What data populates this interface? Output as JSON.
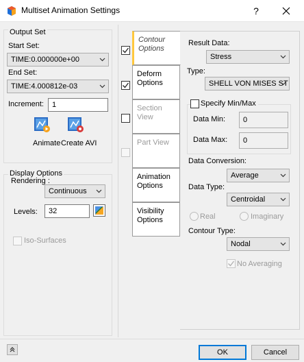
{
  "window": {
    "title": "Multiset Animation Settings",
    "help_label": "?",
    "close_label": "✕"
  },
  "output_set": {
    "group_label": "Output Set",
    "start_label": "Start Set:",
    "start_value": "TIME:0.000000e+00",
    "end_label": "End Set:",
    "end_value": "TIME:4.000812e-03",
    "increment_label": "Increment:",
    "increment_value": "1",
    "animate_label": "Animate",
    "create_avi_label": "Create AVI"
  },
  "display_options": {
    "group_label": "Display Options",
    "rendering_label": "Rendering :",
    "rendering_value": "Continuous",
    "levels_label": "Levels:",
    "levels_value": "32",
    "iso_surfaces_label": "Iso-Surfaces"
  },
  "tabs": [
    {
      "label": "Contour Options",
      "checked": true,
      "active": true
    },
    {
      "label": "Deform Options",
      "checked": true,
      "active": false
    },
    {
      "label": "Section View",
      "checked": false,
      "active": false
    },
    {
      "label": "Part View",
      "checked": false,
      "active": false
    },
    {
      "label": "Animation Options",
      "active": false
    },
    {
      "label": "Visibility Options",
      "active": false
    }
  ],
  "contour": {
    "result_data_label": "Result Data:",
    "result_data_value": "Stress",
    "type_label": "Type:",
    "type_value": "SHELL VON MISES ST",
    "specify_minmax_label": "Specify Min/Max",
    "data_min_label": "Data Min:",
    "data_min_value": "0",
    "data_max_label": "Data Max:",
    "data_max_value": "0",
    "data_conversion_label": "Data Conversion:",
    "data_conversion_value": "Average",
    "data_type_label": "Data Type:",
    "data_type_value": "Centroidal",
    "real_label": "Real",
    "imaginary_label": "Imaginary",
    "contour_type_label": "Contour Type:",
    "contour_type_value": "Nodal",
    "no_averaging_label": "No Averaging"
  },
  "footer": {
    "expand_icon_label": "»",
    "ok_label": "OK",
    "cancel_label": "Cancel"
  }
}
